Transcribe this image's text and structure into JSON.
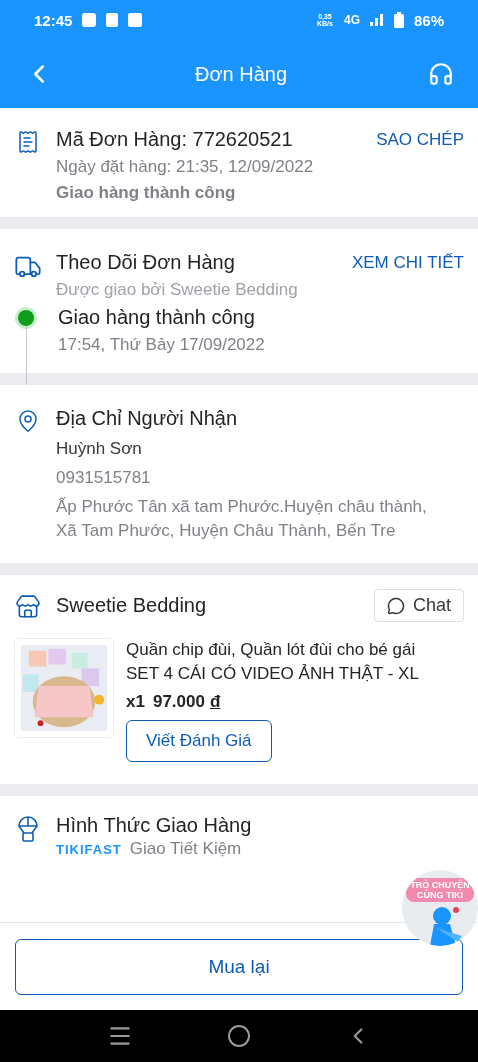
{
  "status_bar": {
    "time": "12:45",
    "net_speed": "0,35 KB/s",
    "network": "4G",
    "battery": "86%"
  },
  "header": {
    "title": "Đơn Hàng"
  },
  "order": {
    "code": "Mã Đơn Hàng: 772620521",
    "copy": "SAO CHÉP",
    "date": "Ngày đặt hàng: 21:35, 12/09/2022",
    "status": "Giao hàng thành công"
  },
  "tracking": {
    "title": "Theo Dõi Đơn Hàng",
    "link": "XEM CHI TIẾT",
    "carrier": "Được giao bởi Sweetie Bedding",
    "events": [
      {
        "status": "Giao hàng thành công",
        "time": "17:54, Thứ Bảy 17/09/2022",
        "color": "#0f9d1c"
      }
    ]
  },
  "address": {
    "title": "Địa Chỉ Người Nhận",
    "name": "Huỳnh Sơn",
    "phone": "0931515781",
    "lines": [
      "Ấp Phước Tân xã tam Phước.Huyện châu thành,",
      "Xã Tam Phước, Huyện Châu Thành, Bến Tre"
    ]
  },
  "shop": {
    "name": "Sweetie Bedding",
    "chat": "Chat",
    "items": [
      {
        "name": "Quần chip đùi, Quần lót đùi cho bé gái SET 4 CÁI CÓ VIDEO ẢNH THẬT - XL",
        "quantity": "x1",
        "price": "97.000",
        "currency": "đ",
        "review": "Viết Đánh Giá"
      }
    ]
  },
  "shipping": {
    "title": "Hình Thức Giao Hàng",
    "logo": "TIKIFAST",
    "method": "Giao Tiết Kiệm"
  },
  "chat_bubble": {
    "label": "TRÒ CHUYỆN CÙNG TIKI"
  },
  "rebuy": "Mua lại"
}
